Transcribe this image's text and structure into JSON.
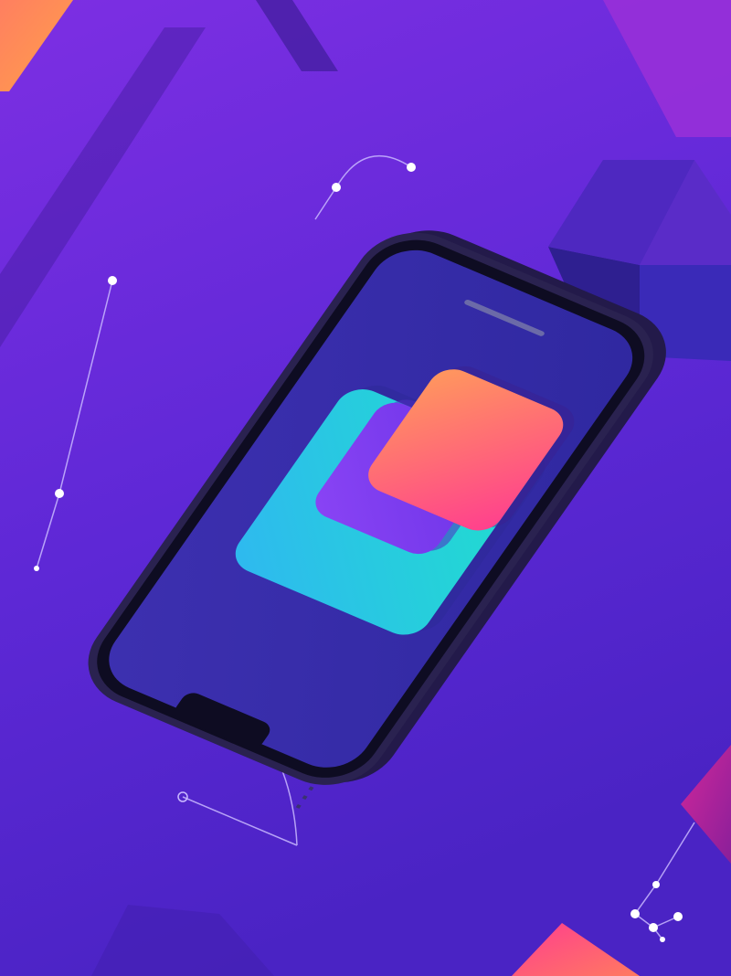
{
  "scene": {
    "description_icons": [
      "smartphone-icon",
      "app-layers-icon",
      "cube-icon",
      "network-node-icon"
    ],
    "colors": {
      "bg_top": "#7a2ee0",
      "bg_bottom": "#4a25c8",
      "phone_frame": "#2a2250",
      "phone_screen": "#3a2ea8",
      "card_cyan": "#22d3e6",
      "card_violet": "#7a3cf0",
      "card_coral": "#ff5f8a",
      "card_orange": "#ff9a5a",
      "cube_blue": "#3a2ab8",
      "accent_magenta": "#c22aa0"
    }
  }
}
